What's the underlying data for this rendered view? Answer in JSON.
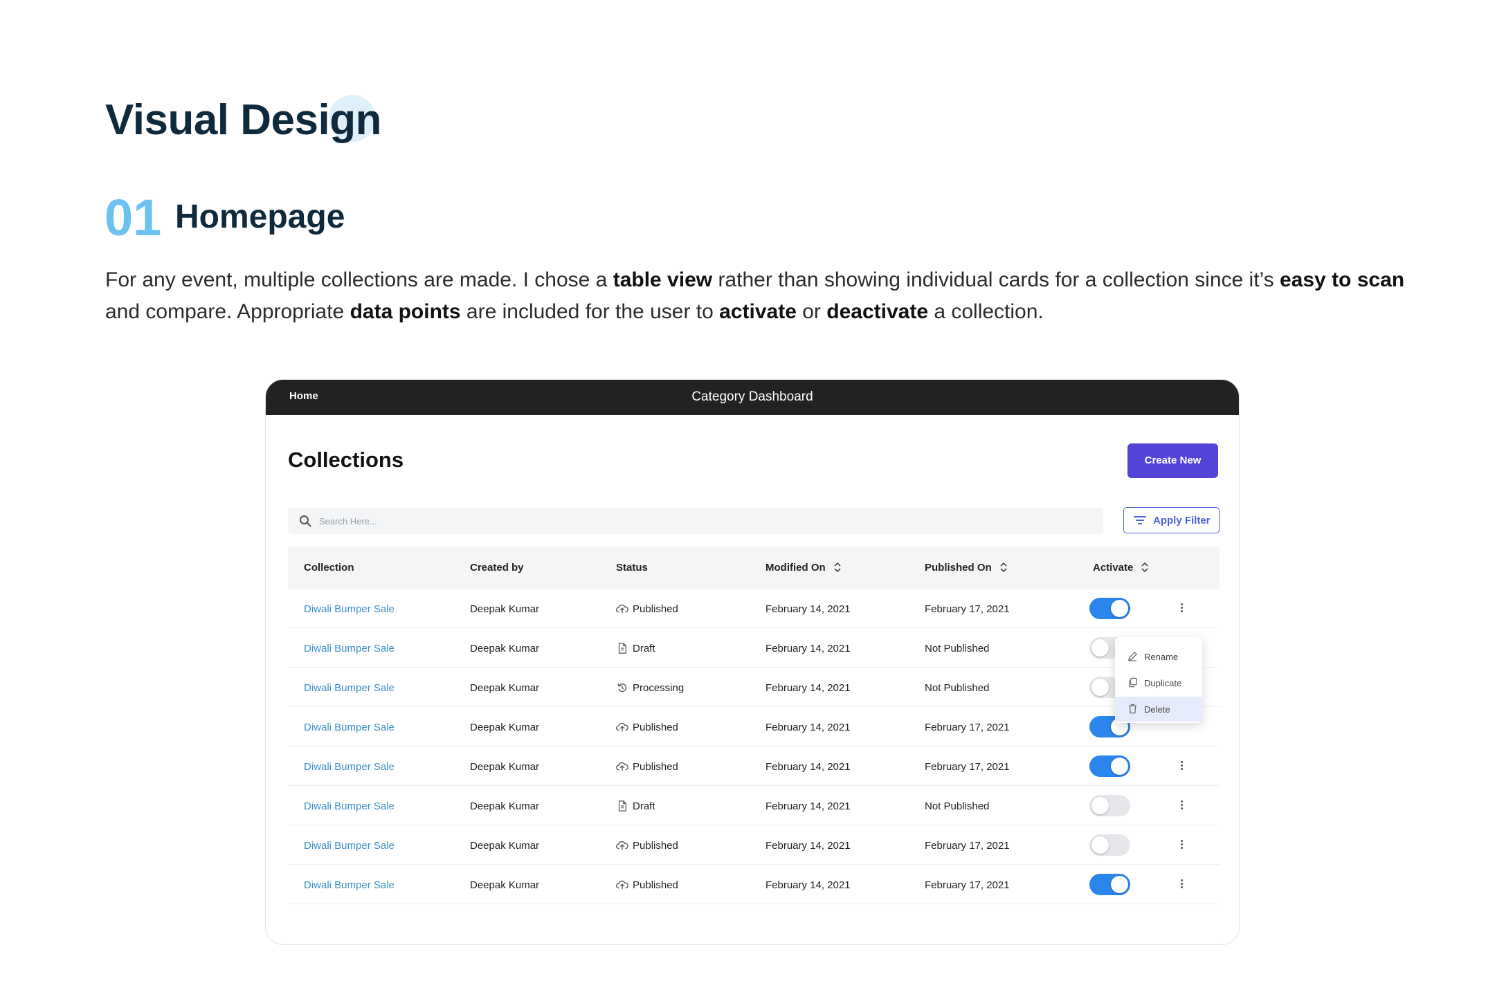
{
  "heading": {
    "title": "Visual Design",
    "section_number": "01",
    "section_title": "Homepage"
  },
  "intro": {
    "p1": "For any event, multiple collections are made. I chose a ",
    "b1": "table view",
    "p2": " rather than showing individual cards for a collection since it’s ",
    "b2": "easy to scan",
    "p3": " and compare. Appropriate ",
    "b3": "data points",
    "p4": " are included for the user to ",
    "b4": "activate",
    "p5": " or ",
    "b5": "deactivate",
    "p6": " a collection."
  },
  "app": {
    "topbar": {
      "home_label": "Home",
      "title": "Category Dashboard"
    },
    "page_title": "Collections",
    "create_button": "Create New",
    "search": {
      "placeholder": "Search Here...",
      "value": ""
    },
    "filter_button": "Apply Filter",
    "columns": {
      "collection": "Collection",
      "created_by": "Created by",
      "status": "Status",
      "modified_on": "Modified On",
      "published_on": "Published On",
      "activate": "Activate"
    },
    "rows": [
      {
        "collection": "Diwali Bumper Sale",
        "created_by": "Deepak Kumar",
        "status": "Published",
        "status_icon": "cloud-upload-icon",
        "modified_on": "February 14, 2021",
        "published_on": "February 17, 2021",
        "active": true
      },
      {
        "collection": "Diwali Bumper Sale",
        "created_by": "Deepak Kumar",
        "status": "Draft",
        "status_icon": "draft-icon",
        "modified_on": "February 14, 2021",
        "published_on": "Not Published",
        "active": false
      },
      {
        "collection": "Diwali Bumper Sale",
        "created_by": "Deepak Kumar",
        "status": "Processing",
        "status_icon": "processing-icon",
        "modified_on": "February 14, 2021",
        "published_on": "Not Published",
        "active": false
      },
      {
        "collection": "Diwali Bumper Sale",
        "created_by": "Deepak Kumar",
        "status": "Published",
        "status_icon": "cloud-upload-icon",
        "modified_on": "February 14, 2021",
        "published_on": "February 17, 2021",
        "active": true
      },
      {
        "collection": "Diwali Bumper Sale",
        "created_by": "Deepak Kumar",
        "status": "Published",
        "status_icon": "cloud-upload-icon",
        "modified_on": "February 14, 2021",
        "published_on": "February 17, 2021",
        "active": true
      },
      {
        "collection": "Diwali Bumper Sale",
        "created_by": "Deepak Kumar",
        "status": "Draft",
        "status_icon": "draft-icon",
        "modified_on": "February 14, 2021",
        "published_on": "Not Published",
        "active": false
      },
      {
        "collection": "Diwali Bumper Sale",
        "created_by": "Deepak Kumar",
        "status": "Published",
        "status_icon": "cloud-upload-icon",
        "modified_on": "February 14, 2021",
        "published_on": "February 17, 2021",
        "active": false
      },
      {
        "collection": "Diwali Bumper Sale",
        "created_by": "Deepak Kumar",
        "status": "Published",
        "status_icon": "cloud-upload-icon",
        "modified_on": "February 14, 2021",
        "published_on": "February 17, 2021",
        "active": true
      }
    ],
    "context_menu": {
      "items": [
        {
          "label": "Rename",
          "icon": "pencil-icon"
        },
        {
          "label": "Duplicate",
          "icon": "copy-icon"
        },
        {
          "label": "Delete",
          "icon": "trash-icon",
          "highlighted": true
        }
      ]
    },
    "colors": {
      "accent": "#5343d8",
      "toggle_on": "#2a85ec",
      "link": "#3b8fc6",
      "section_number": "#6cc1f0",
      "topbar": "#222222"
    }
  }
}
